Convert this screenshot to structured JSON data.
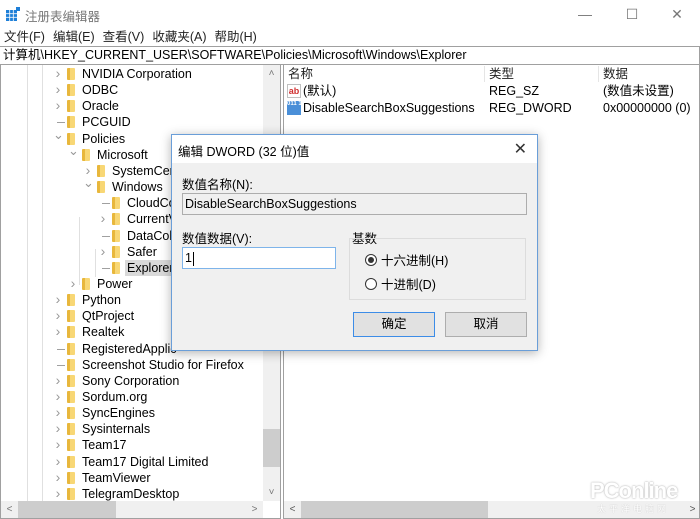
{
  "window": {
    "title": "注册表编辑器",
    "app_icon": "registry-editor-icon",
    "controls": {
      "minimize": "—",
      "maximize": "☐",
      "close": "✕"
    }
  },
  "menubar": [
    {
      "label": "文件(F)"
    },
    {
      "label": "编辑(E)"
    },
    {
      "label": "查看(V)"
    },
    {
      "label": "收藏夹(A)"
    },
    {
      "label": "帮助(H)"
    }
  ],
  "address": "计算机\\HKEY_CURRENT_USER\\SOFTWARE\\Policies\\Microsoft\\Windows\\Explorer",
  "tree": {
    "items": [
      {
        "label": "NVIDIA Corporation",
        "level": 0,
        "expander": "collapsed"
      },
      {
        "label": "ODBC",
        "level": 0,
        "expander": "collapsed"
      },
      {
        "label": "Oracle",
        "level": 0,
        "expander": "collapsed"
      },
      {
        "label": "PCGUID",
        "level": 0,
        "expander": "none"
      },
      {
        "label": "Policies",
        "level": 0,
        "expander": "expanded"
      },
      {
        "label": "Microsoft",
        "level": 1,
        "expander": "expanded"
      },
      {
        "label": "SystemCert",
        "level": 2,
        "expander": "collapsed"
      },
      {
        "label": "Windows",
        "level": 2,
        "expander": "expanded"
      },
      {
        "label": "CloudCo",
        "level": 3,
        "expander": "none"
      },
      {
        "label": "CurrentV",
        "level": 3,
        "expander": "collapsed"
      },
      {
        "label": "DataColl",
        "level": 3,
        "expander": "none"
      },
      {
        "label": "Safer",
        "level": 3,
        "expander": "collapsed"
      },
      {
        "label": "Explorer",
        "level": 3,
        "expander": "none",
        "selected": true
      },
      {
        "label": "Power",
        "level": 1,
        "expander": "collapsed"
      },
      {
        "label": "Python",
        "level": 0,
        "expander": "collapsed"
      },
      {
        "label": "QtProject",
        "level": 0,
        "expander": "collapsed"
      },
      {
        "label": "Realtek",
        "level": 0,
        "expander": "collapsed"
      },
      {
        "label": "RegisteredApplic",
        "level": 0,
        "expander": "none"
      },
      {
        "label": "Screenshot Studio for Firefox",
        "level": 0,
        "expander": "none"
      },
      {
        "label": "Sony Corporation",
        "level": 0,
        "expander": "collapsed"
      },
      {
        "label": "Sordum.org",
        "level": 0,
        "expander": "collapsed"
      },
      {
        "label": "SyncEngines",
        "level": 0,
        "expander": "collapsed"
      },
      {
        "label": "Sysinternals",
        "level": 0,
        "expander": "collapsed"
      },
      {
        "label": "Team17",
        "level": 0,
        "expander": "collapsed"
      },
      {
        "label": "Team17 Digital Limited",
        "level": 0,
        "expander": "collapsed"
      },
      {
        "label": "TeamViewer",
        "level": 0,
        "expander": "collapsed"
      },
      {
        "label": "TelegramDesktop",
        "level": 0,
        "expander": "collapsed"
      }
    ],
    "scroll_arrows": {
      "up": "˄",
      "down": "˅",
      "left": "<",
      "right": ">"
    }
  },
  "list": {
    "columns": [
      "名称",
      "类型",
      "数据"
    ],
    "rows": [
      {
        "icon": "string-value-icon",
        "icon_text": "ab",
        "name": "(默认)",
        "type": "REG_SZ",
        "data": "(数值未设置)"
      },
      {
        "icon": "dword-value-icon",
        "icon_text": "011 110",
        "name": "DisableSearchBoxSuggestions",
        "type": "REG_DWORD",
        "data": "0x00000000 (0)"
      }
    ],
    "scroll_arrows": {
      "left": "<",
      "right": ">"
    }
  },
  "dialog": {
    "title": "编辑 DWORD (32 位)值",
    "close": "✕",
    "name_label": "数值名称(N):",
    "name_value": "DisableSearchBoxSuggestions",
    "data_label": "数值数据(V):",
    "data_value": "1",
    "base_label": "基数",
    "radios": [
      {
        "label": "十六进制(H)",
        "checked": true
      },
      {
        "label": "十进制(D)",
        "checked": false
      }
    ],
    "ok_label": "确定",
    "cancel_label": "取消"
  },
  "watermark": {
    "brand": "PConline",
    "sub": "太平洋电脑网"
  }
}
